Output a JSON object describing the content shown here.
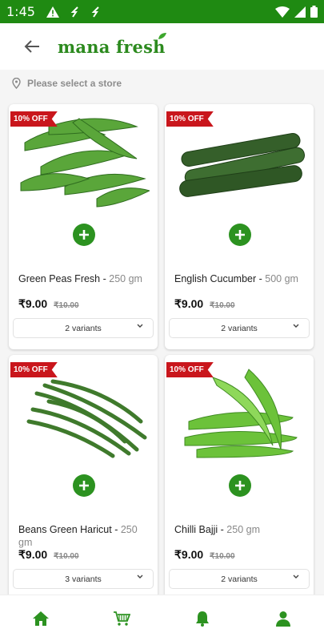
{
  "status_bar": {
    "time": "1:45"
  },
  "header": {
    "logo": "mana fresh"
  },
  "store": {
    "label": "Please select a store"
  },
  "products": [
    {
      "offer": "10% OFF",
      "name": "Green Peas Fresh",
      "weight": "250 gm",
      "price": "₹9.00",
      "mrp": "₹10.00",
      "variants": "2 variants"
    },
    {
      "offer": "10% OFF",
      "name": "English Cucumber",
      "weight": "500 gm",
      "price": "₹9.00",
      "mrp": "₹10.00",
      "variants": "2 variants"
    },
    {
      "offer": "10% OFF",
      "name": "Beans Green Haricut",
      "weight": "250 gm",
      "price": "₹9.00",
      "mrp": "₹10.00",
      "variants": "3 variants"
    },
    {
      "offer": "10% OFF",
      "name": "Chilli Bajji",
      "weight": "250 gm",
      "price": "₹9.00",
      "mrp": "₹10.00",
      "variants": "2 variants"
    }
  ],
  "icons": {
    "home": "home-icon",
    "cart": "cart-icon",
    "notifications": "bell-icon",
    "profile": "user-icon"
  },
  "colors": {
    "brand_green": "#2c9220",
    "status_green": "#1f8a12",
    "offer_red": "#c9161c"
  }
}
